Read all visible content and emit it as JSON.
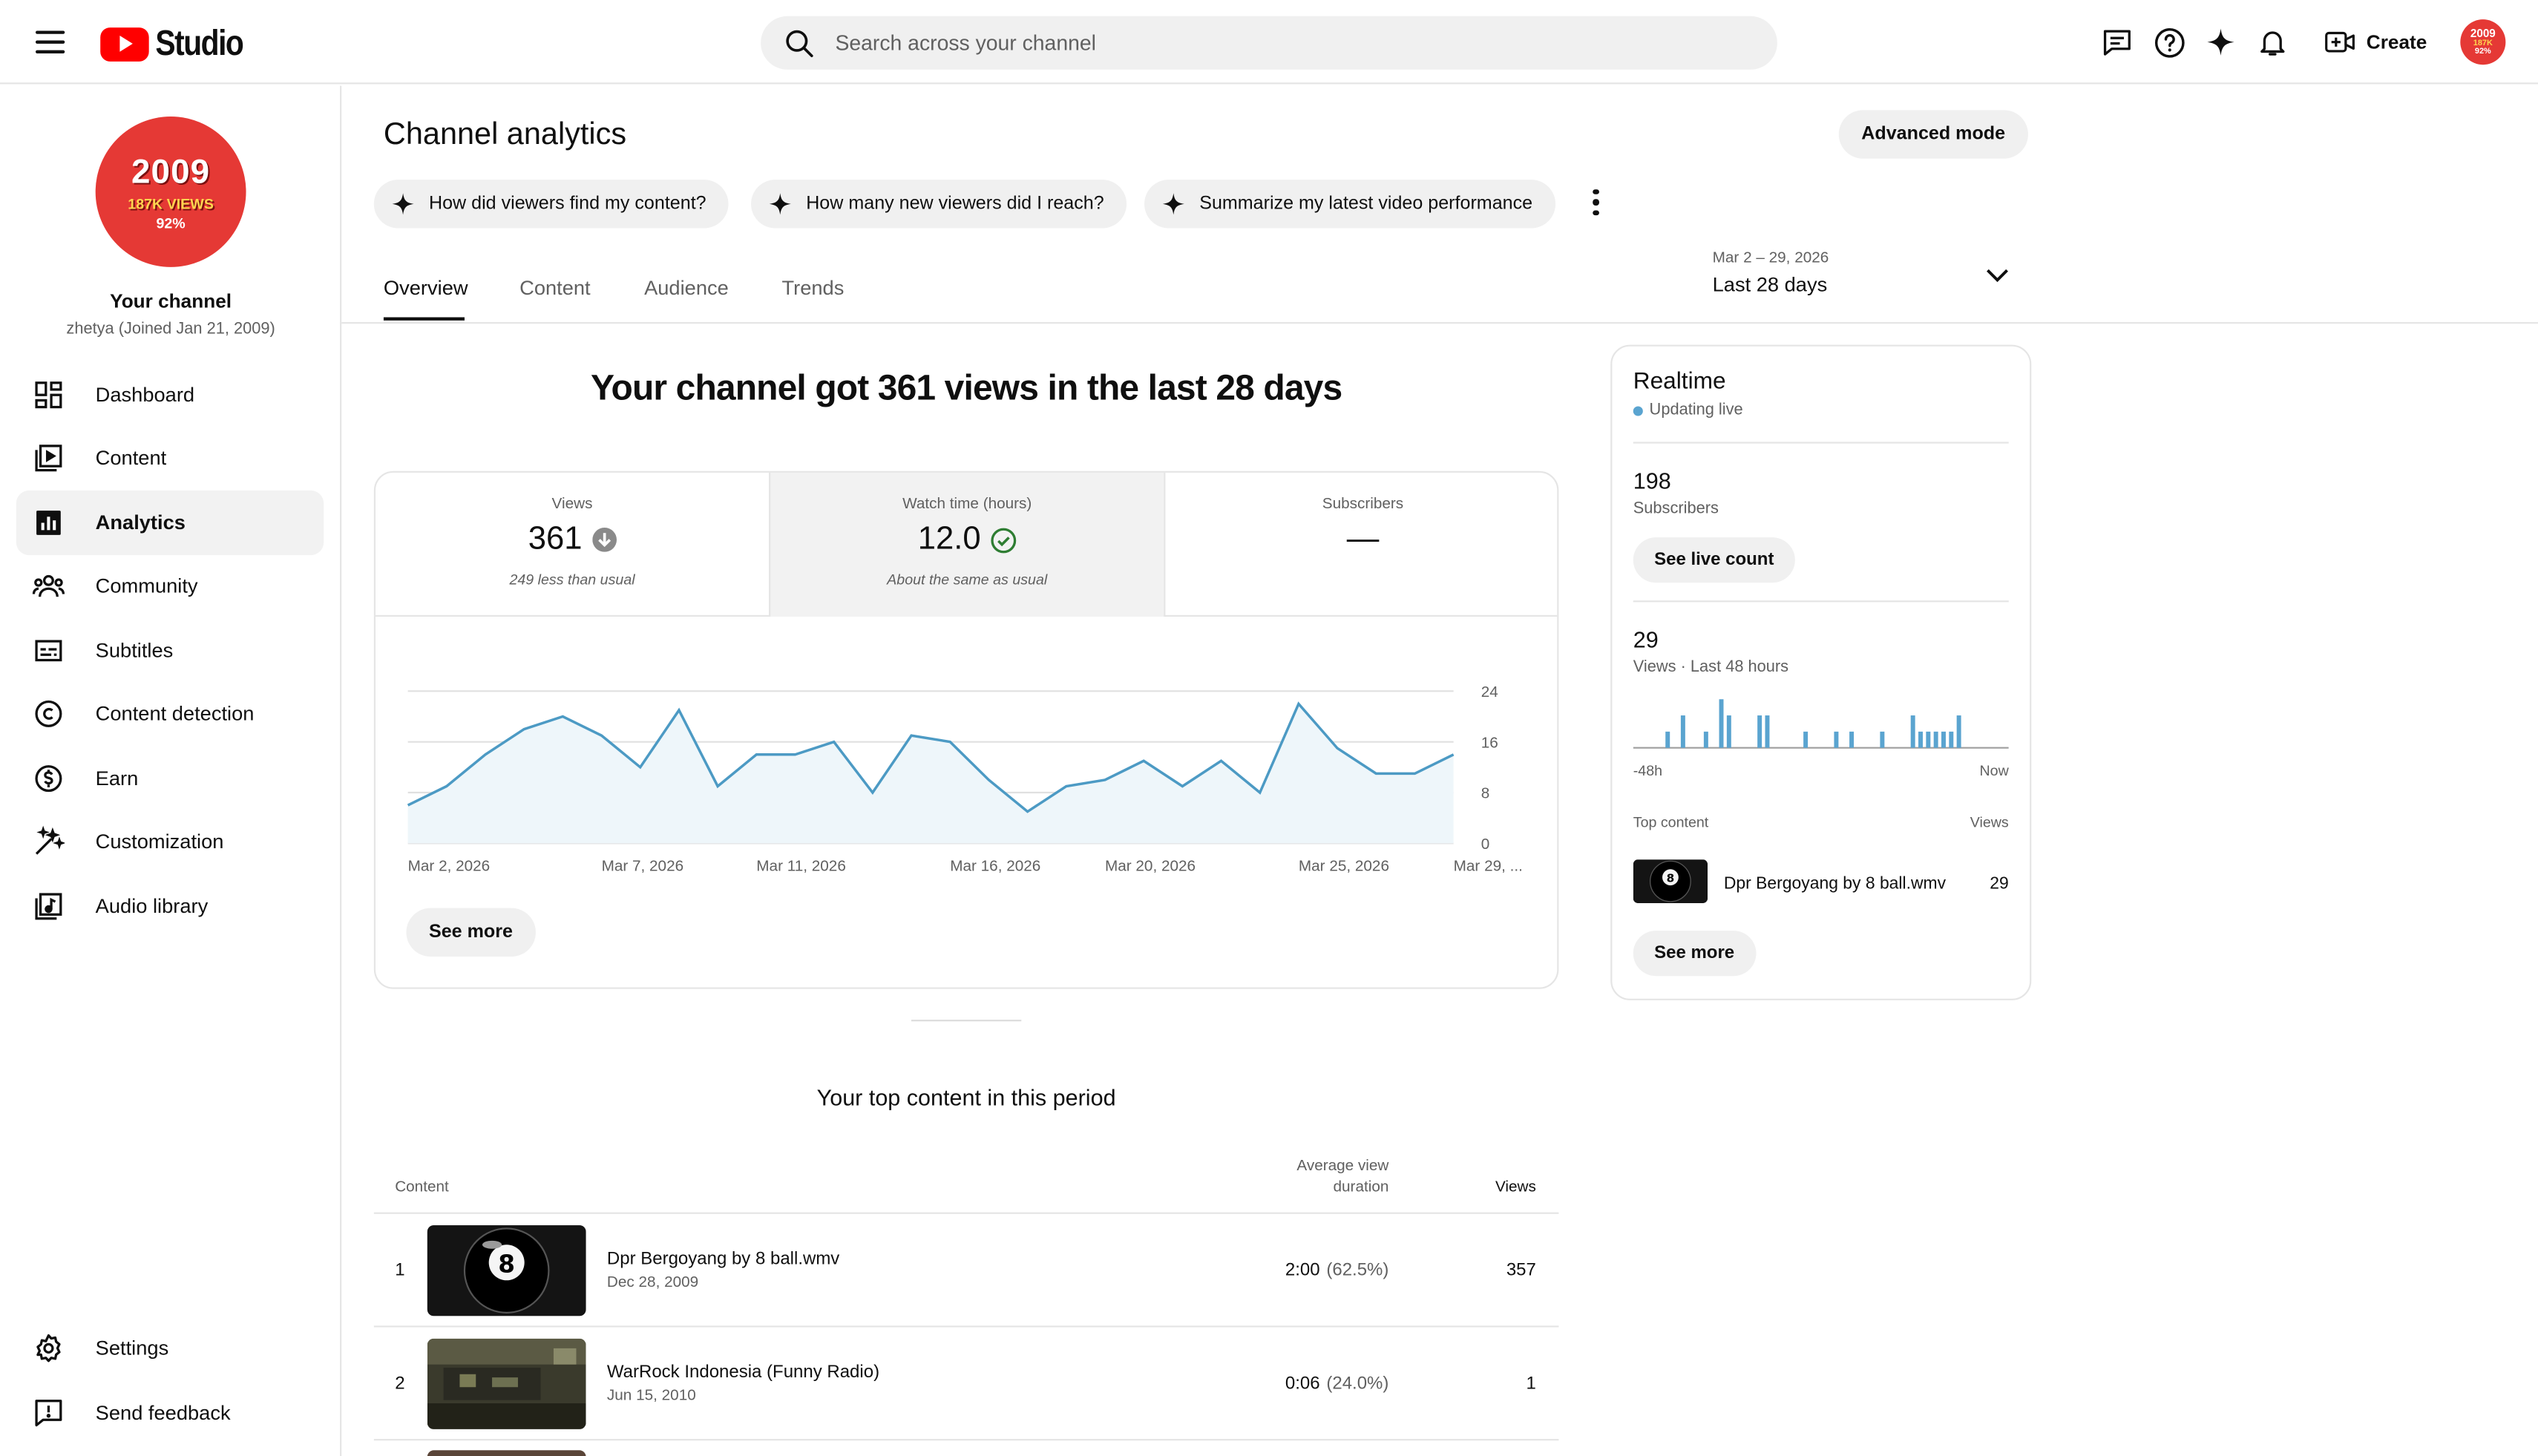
{
  "header": {
    "logo_text": "Studio",
    "search_placeholder": "Search across your channel",
    "create_label": "Create",
    "avatar_lines": [
      "2009",
      "187K",
      "92%"
    ]
  },
  "sidebar": {
    "avatar": {
      "year": "2009",
      "views": "187K VIEWS",
      "percent": "92%"
    },
    "channel_name": "Your channel",
    "channel_sub": "zhetya (Joined Jan 21, 2009)",
    "items": [
      {
        "label": "Dashboard",
        "icon": "dashboard-icon"
      },
      {
        "label": "Content",
        "icon": "content-icon"
      },
      {
        "label": "Analytics",
        "icon": "analytics-icon",
        "active": true
      },
      {
        "label": "Community",
        "icon": "community-icon"
      },
      {
        "label": "Subtitles",
        "icon": "subtitles-icon"
      },
      {
        "label": "Content detection",
        "icon": "copyright-icon"
      },
      {
        "label": "Earn",
        "icon": "earn-icon"
      },
      {
        "label": "Customization",
        "icon": "customization-icon"
      },
      {
        "label": "Audio library",
        "icon": "audio-library-icon"
      }
    ],
    "bottom_items": [
      {
        "label": "Settings",
        "icon": "settings-icon"
      },
      {
        "label": "Send feedback",
        "icon": "feedback-icon"
      }
    ]
  },
  "main": {
    "title": "Channel analytics",
    "advanced_label": "Advanced mode",
    "chips": [
      "How did viewers find my content?",
      "How many new viewers did I reach?",
      "Summarize my latest video performance"
    ],
    "tabs": [
      "Overview",
      "Content",
      "Audience",
      "Trends"
    ],
    "active_tab": "Overview",
    "date_range": "Mar 2 – 29, 2026",
    "date_label": "Last 28 days",
    "headline": "Your channel got 361 views in the last 28 days",
    "metrics": [
      {
        "title": "Views",
        "value": "361",
        "caption": "249 less than usual",
        "indicator": "arrow-down-icon"
      },
      {
        "title": "Watch time (hours)",
        "value": "12.0",
        "caption": "About the same as usual",
        "indicator": "check-circle-icon"
      },
      {
        "title": "Subscribers",
        "value": "—",
        "caption": ""
      }
    ],
    "see_more_label": "See more",
    "top_content": {
      "title": "Your top content in this period",
      "col_content": "Content",
      "col_avd": "Average view duration",
      "col_views": "Views",
      "rows": [
        {
          "rank": "1",
          "title": "Dpr Bergoyang by 8 ball.wmv",
          "date": "Dec 28, 2009",
          "duration": "2:00",
          "percent": "(62.5%)",
          "views": "357"
        },
        {
          "rank": "2",
          "title": "WarRock Indonesia (Funny Radio)",
          "date": "Jun 15, 2010",
          "duration": "0:06",
          "percent": "(24.0%)",
          "views": "1"
        }
      ]
    }
  },
  "chart_data": {
    "type": "area",
    "title": "",
    "x": [
      "Mar 2, 2026",
      "Mar 3",
      "Mar 4",
      "Mar 5",
      "Mar 6",
      "Mar 7, 2026",
      "Mar 8",
      "Mar 9",
      "Mar 10",
      "Mar 11, 2026",
      "Mar 12",
      "Mar 13",
      "Mar 14",
      "Mar 15",
      "Mar 16, 2026",
      "Mar 17",
      "Mar 18",
      "Mar 19",
      "Mar 20, 2026",
      "Mar 21",
      "Mar 22",
      "Mar 23",
      "Mar 24",
      "Mar 25, 2026",
      "Mar 26",
      "Mar 27",
      "Mar 28",
      "Mar 29"
    ],
    "x_tick_labels": [
      "Mar 2, 2026",
      "Mar 7, 2026",
      "Mar 11, 2026",
      "Mar 16, 2026",
      "Mar 20, 2026",
      "Mar 25, 2026",
      "Mar 29, ..."
    ],
    "x_tick_indices": [
      0,
      5,
      9,
      14,
      18,
      23,
      27
    ],
    "series": [
      {
        "name": "Views",
        "values": [
          6,
          9,
          14,
          18,
          20,
          17,
          12,
          21,
          9,
          14,
          14,
          16,
          8,
          17,
          16,
          10,
          5,
          9,
          10,
          13,
          9,
          13,
          8,
          22,
          15,
          11,
          11,
          14
        ]
      }
    ],
    "y_ticks": [
      0,
      8,
      16,
      24
    ],
    "ylim": [
      0,
      24
    ],
    "grid": true,
    "color": "#4c9ac4"
  },
  "realtime": {
    "title": "Realtime",
    "live_label": "Updating live",
    "subs_value": "198",
    "subs_label": "Subscribers",
    "live_count_label": "See live count",
    "views_value": "29",
    "views_label": "Views · Last 48 hours",
    "axis_start": "-48h",
    "axis_end": "Now",
    "hourly_views": [
      0,
      0,
      0,
      0,
      1,
      0,
      2,
      0,
      0,
      1,
      0,
      3,
      2,
      0,
      0,
      0,
      2,
      2,
      0,
      0,
      0,
      0,
      1,
      0,
      0,
      0,
      1,
      0,
      1,
      0,
      0,
      0,
      1,
      0,
      0,
      0,
      2,
      1,
      1,
      1,
      1,
      1,
      2,
      0,
      0,
      0,
      0,
      0,
      0
    ],
    "top_content_label": "Top content",
    "views_col_label": "Views",
    "top_item_title": "Dpr Bergoyang by 8 ball.wmv",
    "top_item_views": "29",
    "see_more_label": "See more"
  }
}
